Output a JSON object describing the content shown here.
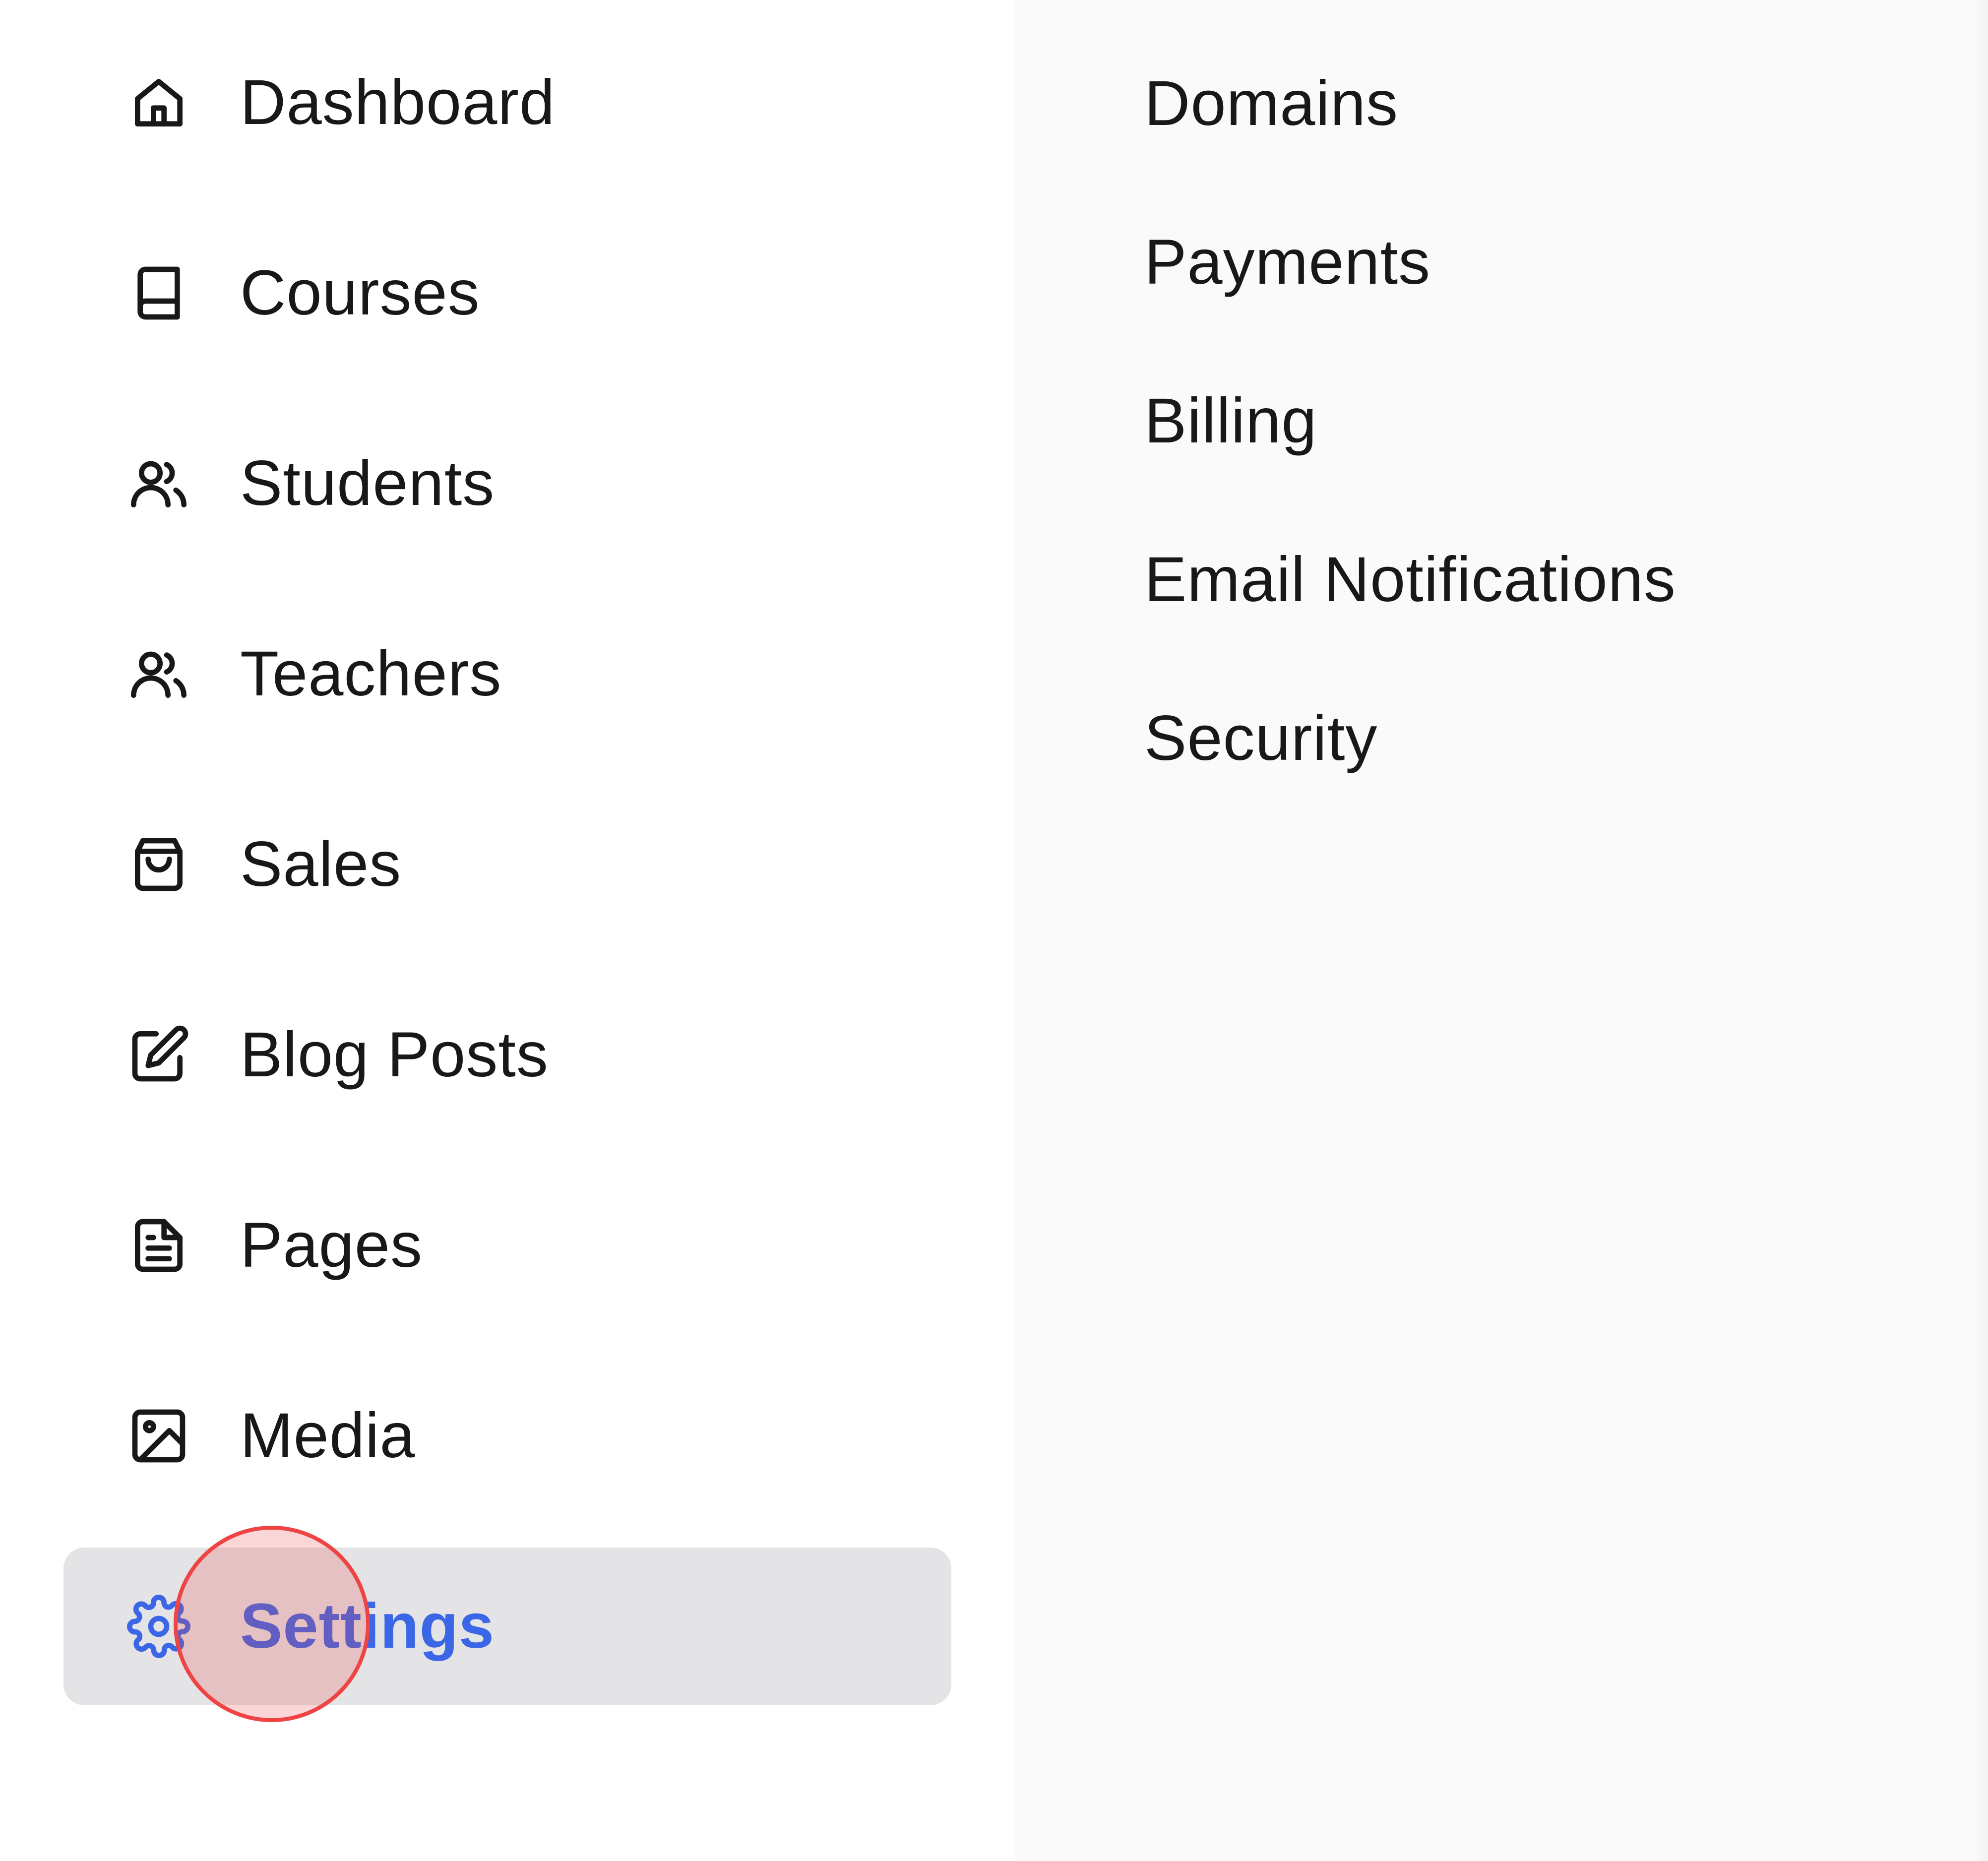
{
  "sidebar": {
    "items": [
      {
        "label": "Dashboard",
        "icon": "home-icon",
        "active": false
      },
      {
        "label": "Courses",
        "icon": "book-icon",
        "active": false
      },
      {
        "label": "Students",
        "icon": "users-icon",
        "active": false
      },
      {
        "label": "Teachers",
        "icon": "users-icon",
        "active": false
      },
      {
        "label": "Sales",
        "icon": "shopping-bag-icon",
        "active": false
      },
      {
        "label": "Blog Posts",
        "icon": "edit-icon",
        "active": false
      },
      {
        "label": "Pages",
        "icon": "file-text-icon",
        "active": false
      },
      {
        "label": "Media",
        "icon": "image-icon",
        "active": false
      },
      {
        "label": "Settings",
        "icon": "gear-icon",
        "active": true
      }
    ]
  },
  "settings_menu": {
    "items": [
      {
        "label": "Domains"
      },
      {
        "label": "Payments"
      },
      {
        "label": "Billing"
      },
      {
        "label": "Email Notifications"
      },
      {
        "label": "Security"
      }
    ]
  },
  "colors": {
    "text": "#18181b",
    "active_text": "#3b66e6",
    "active_background": "#e4e4e7",
    "panel_background": "#fafafa",
    "click_marker": "#ef4444"
  }
}
